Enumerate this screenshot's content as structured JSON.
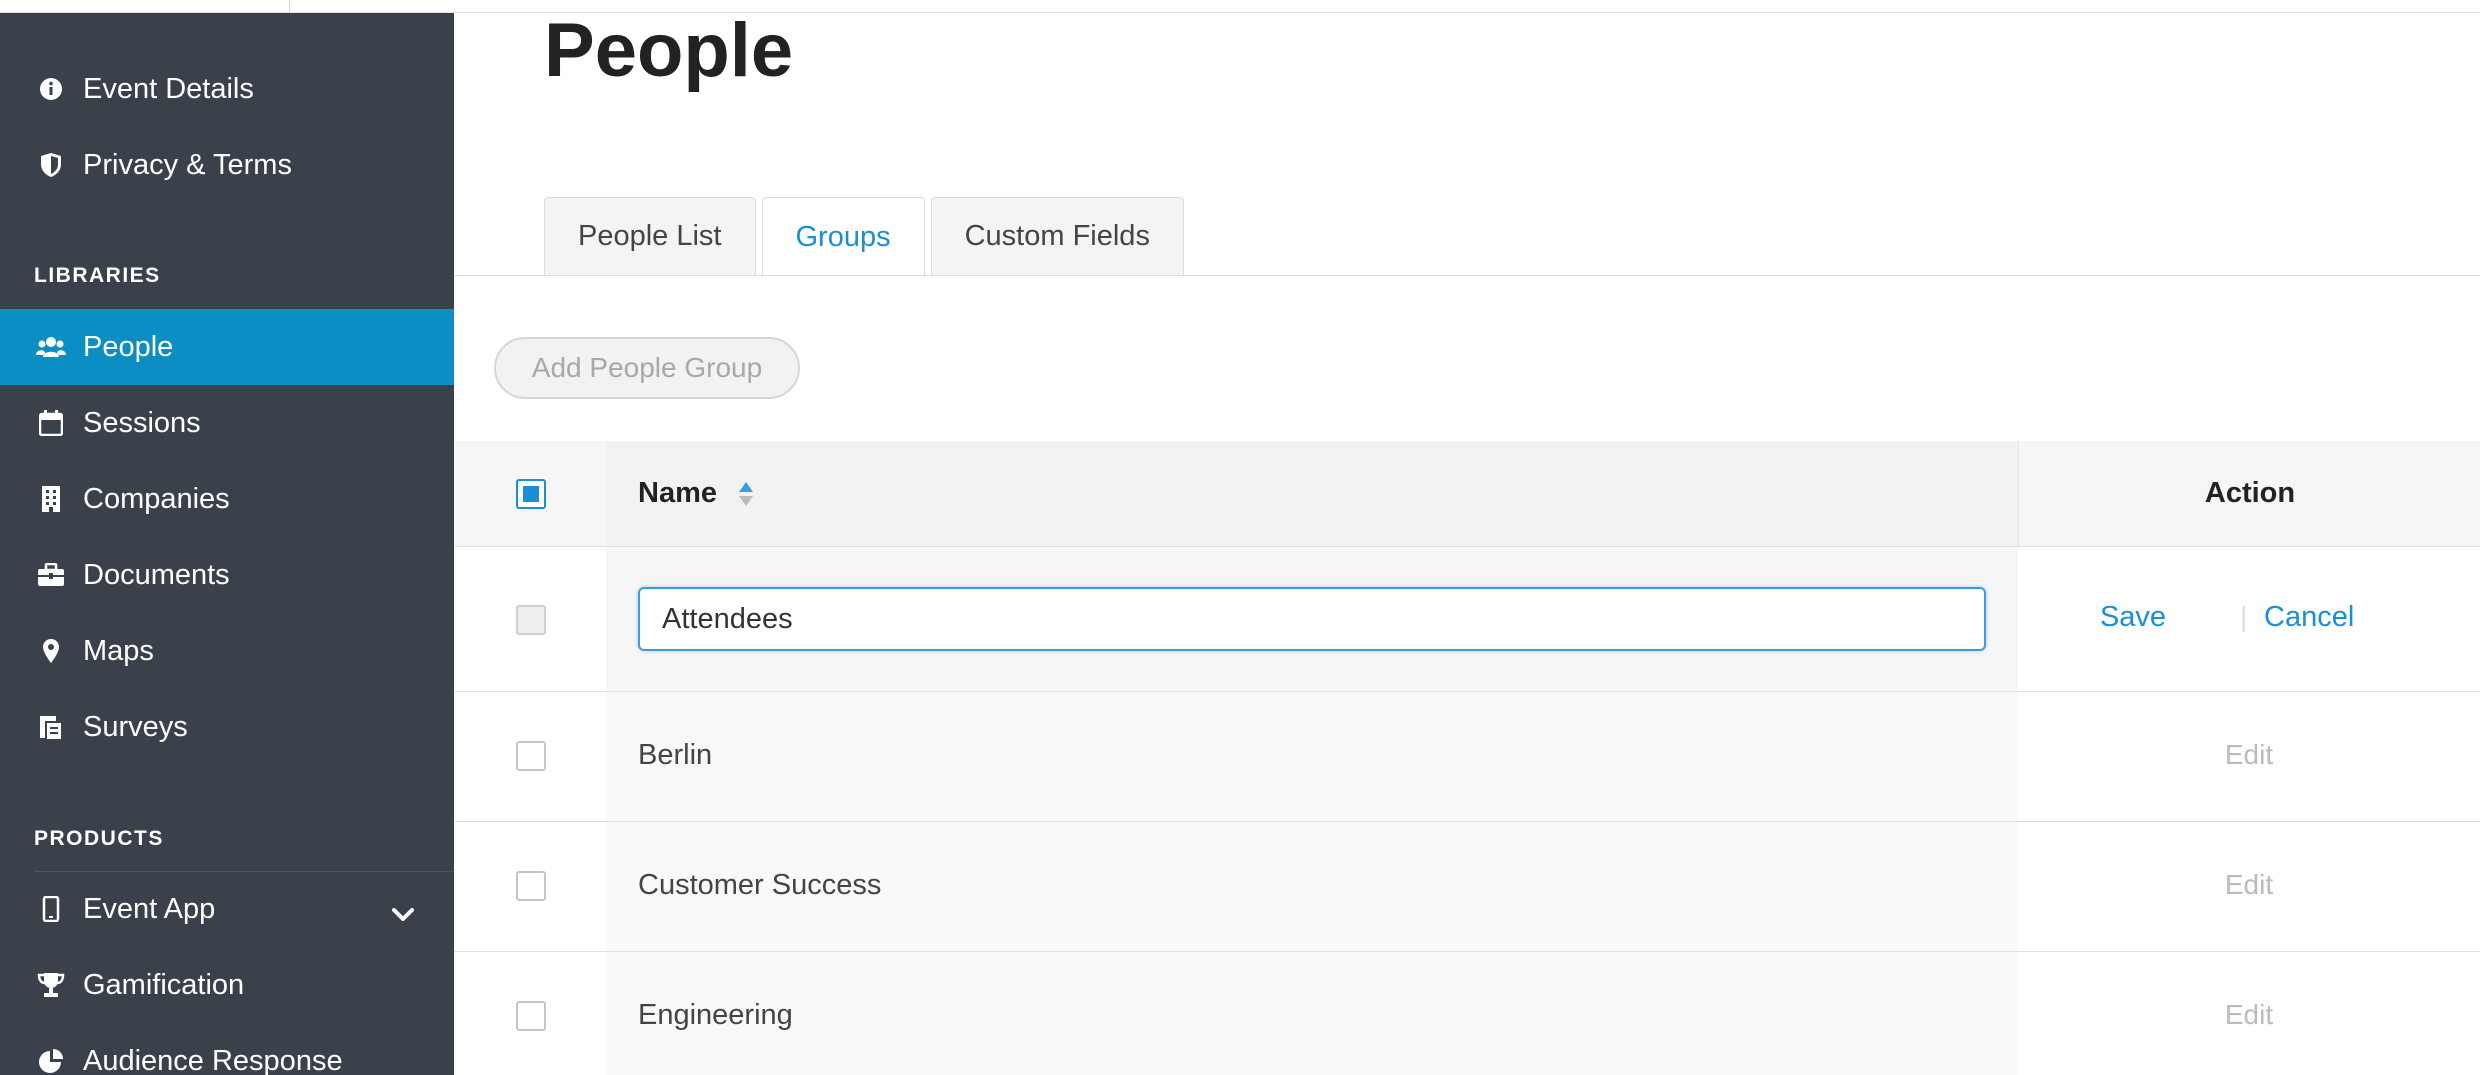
{
  "sidebar": {
    "items_top": [
      {
        "label": "Event Details",
        "icon": "info-circle-icon"
      },
      {
        "label": "Privacy & Terms",
        "icon": "shield-icon"
      }
    ],
    "libraries_title": "LIBRARIES",
    "libraries": [
      {
        "label": "People",
        "icon": "users-icon",
        "active": true
      },
      {
        "label": "Sessions",
        "icon": "calendar-icon"
      },
      {
        "label": "Companies",
        "icon": "building-icon"
      },
      {
        "label": "Documents",
        "icon": "briefcase-icon"
      },
      {
        "label": "Maps",
        "icon": "map-marker-icon"
      },
      {
        "label": "Surveys",
        "icon": "clipboard-icon"
      }
    ],
    "products_title": "PRODUCTS",
    "products": [
      {
        "label": "Event App",
        "icon": "mobile-icon"
      },
      {
        "label": "Gamification",
        "icon": "trophy-icon"
      },
      {
        "label": "Audience Response",
        "icon": "pie-chart-icon"
      }
    ]
  },
  "main": {
    "title": "People",
    "tabs": [
      {
        "label": "People List"
      },
      {
        "label": "Groups",
        "active": true
      },
      {
        "label": "Custom Fields"
      }
    ],
    "add_button": "Add People Group",
    "table": {
      "col_name": "Name",
      "col_action": "Action",
      "editing_row": {
        "value": "Attendees",
        "save": "Save",
        "separator": "|",
        "cancel": "Cancel"
      },
      "rows": [
        {
          "name": "Berlin",
          "action": "Edit"
        },
        {
          "name": "Customer Success",
          "action": "Edit"
        },
        {
          "name": "Engineering",
          "action": "Edit"
        }
      ]
    }
  },
  "colors": {
    "sidebar_bg": "#3a414b",
    "active_bg": "#0b8ec4",
    "link": "#1a8fd6"
  }
}
